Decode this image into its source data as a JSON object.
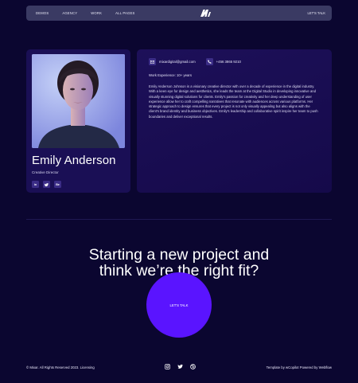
{
  "nav": {
    "links": [
      "DEMOS",
      "AGENCY",
      "WORK",
      "ALL PAGES"
    ],
    "logo_icon": "m-logo-icon",
    "cta": "LET'S TALK"
  },
  "profile": {
    "name": "Emily Anderson",
    "role": "Creative Director",
    "socials": [
      {
        "label": "in",
        "icon": "linkedin-icon"
      },
      {
        "label": "tw",
        "icon": "twitter-icon"
      },
      {
        "label": "Be",
        "icon": "behance-icon"
      }
    ]
  },
  "info": {
    "email": "mixardigital@gmail.com",
    "phone": "+456 3865 9210",
    "experience": "Work Experience: 10+ years",
    "bio": "Emily Anderson Johnson is a visionary creative director with over a decade of experience in the digital industry. With a keen eye for design and aesthetics, she leads the team at the Digital Studio in developing innovative and visually stunning digital solutions for clients. Emily's passion for creativity and her deep understanding of user experience allow her to craft compelling narratives that resonate with audiences across various platforms. Her strategic approach to design ensures that every project is not only visually appealing but also aligns with the client's brand identity and business objectives. Emily's leadership and collaborative spirit inspire her team to push boundaries and deliver exceptional results."
  },
  "cta": {
    "headline_line1": "Starting a new project and",
    "headline_line2": "think we’re the right fit?",
    "button": "LET'S TALK"
  },
  "footer": {
    "left": "© Mixar. All Rights Reserved 2023. Licensing",
    "right": "Template by wCopilot Powered by Webflow",
    "icons": [
      "instagram-icon",
      "twitter-icon",
      "dribbble-icon"
    ]
  },
  "colors": {
    "background": "#0b0630",
    "card": "#1a0f55",
    "accent": "#5a14ff",
    "nav": "#3a3a63"
  }
}
